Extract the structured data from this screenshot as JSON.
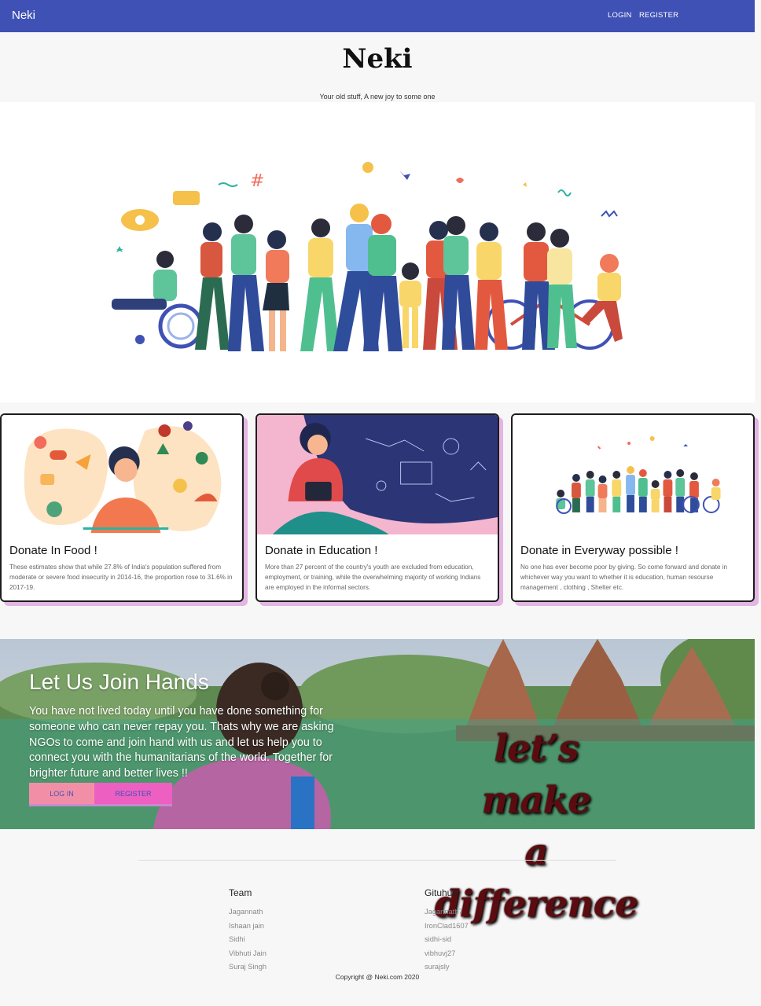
{
  "navbar": {
    "brand": "Neki",
    "links": [
      "LOGIN",
      "REGISTER"
    ],
    "color": "#3f51b5"
  },
  "header": {
    "title": "Neki",
    "tagline": "Your old stuff, A new joy to some one"
  },
  "hero": {
    "illustration": "crowd-of-people-celebrating-illustration"
  },
  "cards": [
    {
      "title": "Donate In Food !",
      "description": "These estimates show that while 27.8% of India's population suffered from moderate or severe food insecurity in 2014-16, the proportion rose to 31.6% in 2017-19.",
      "image": "food-woman-illustration"
    },
    {
      "title": "Donate in Education !",
      "description": "More than 27 percent of the country's youth are excluded from education, employment, or training, while the overwhelming majority of working Indians are employed in the informal sectors.",
      "image": "student-reading-illustration"
    },
    {
      "title": "Donate in Everyway possible !",
      "description": "No one has ever become poor by giving. So come forward and donate in whichever way you want to whether it is education, human resourse management , clothing , Shelter etc.",
      "image": "crowd-illustration"
    }
  ],
  "banner": {
    "title": "Let Us Join Hands",
    "text": "You have not lived today until you have done something for someone who can never repay you. Thats why we are asking NGOs to come and join hand with us and let us help you to connect you with the humanitarians of the world. Together for brighter future and better lives !!",
    "login_label": "LOG IN",
    "register_label": "REGISTER",
    "slogan_line1": "let’s make",
    "slogan_line2": "a difference"
  },
  "footer": {
    "team_heading": "Team",
    "team": [
      "Jagannath",
      "Ishaan jain",
      "Sidhi",
      "Vibhuti Jain",
      "Suraj Singh"
    ],
    "github_heading": "Gituhub",
    "github": [
      "Jagannath7",
      "IronClad1607",
      "sidhi-sid",
      "vibhuvj27",
      "surajsly"
    ],
    "copyright": "Copyright @ Neki.com 2020"
  }
}
